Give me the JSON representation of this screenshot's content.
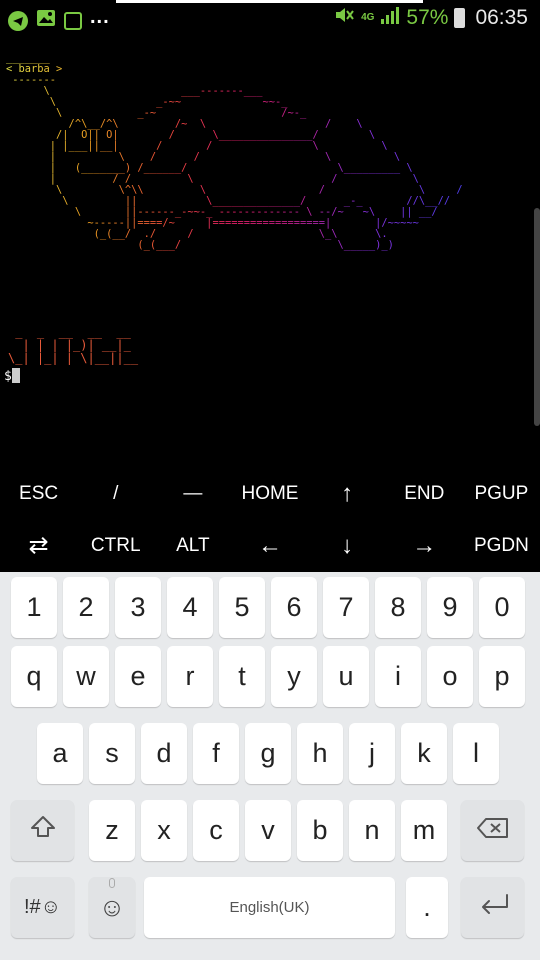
{
  "status_bar": {
    "network": "4G",
    "battery_percent": "57%",
    "battery_level": 0.57,
    "time": "06:35",
    "overflow": "...",
    "accent_color": "#7ac943"
  },
  "terminal": {
    "ascii_art": "_______\n< barba >\n -------\n      \\                     ___-------___\n       \\                _-~~             ~~-_\n        \\            _-~                    /~-_\n          /^\\__/^\\         /~  \\                   /    \\\n        /|  O|| O|        /      \\_______________/        \\\n       | |___||__|      /       /                \\          \\\n       |          \\    /      /                    \\          \\\n       |   (_______) /______/                        \\_________ \\\n       |         / /         \\                      /            \\\n        \\         \\^\\\\         \\                  /               \\     /\n         \\         ||           \\______________/      _-_       //\\__//\n           \\       ||------_-~~-_ ------------- \\ --/~   ~\\    || __/\n             ~-----||====/~     |==================|       |/~~~~~\n              (_(__/  ./     /                    \\_\\      \\.\n                     (_(___/                         \\_____)_)",
    "banner_name": "JORGE",
    "banner_art": " _  _  __  __  __\n  | | | |_)| __|_\n\\_| |_| | \\|__||__",
    "prompt": "$"
  },
  "extra_keys": {
    "row1": [
      "ESC",
      "/",
      "―",
      "HOME",
      "↑",
      "END",
      "PGUP"
    ],
    "row2": [
      "⇄",
      "CTRL",
      "ALT",
      "←",
      "↓",
      "→",
      "PGDN"
    ]
  },
  "keyboard": {
    "digits": [
      "1",
      "2",
      "3",
      "4",
      "5",
      "6",
      "7",
      "8",
      "9",
      "0"
    ],
    "row_q": [
      "q",
      "w",
      "e",
      "r",
      "t",
      "y",
      "u",
      "i",
      "o",
      "p"
    ],
    "row_a": [
      "a",
      "s",
      "d",
      "f",
      "g",
      "h",
      "j",
      "k",
      "l"
    ],
    "row_z": [
      "z",
      "x",
      "c",
      "v",
      "b",
      "n",
      "m"
    ],
    "symbols_label": "!#☺",
    "emoji_label": "☺",
    "space_label": "English(UK)",
    "period_label": ".",
    "shift_icon": "shift-icon",
    "backspace_icon": "backspace-icon",
    "enter_icon": "enter-icon"
  }
}
